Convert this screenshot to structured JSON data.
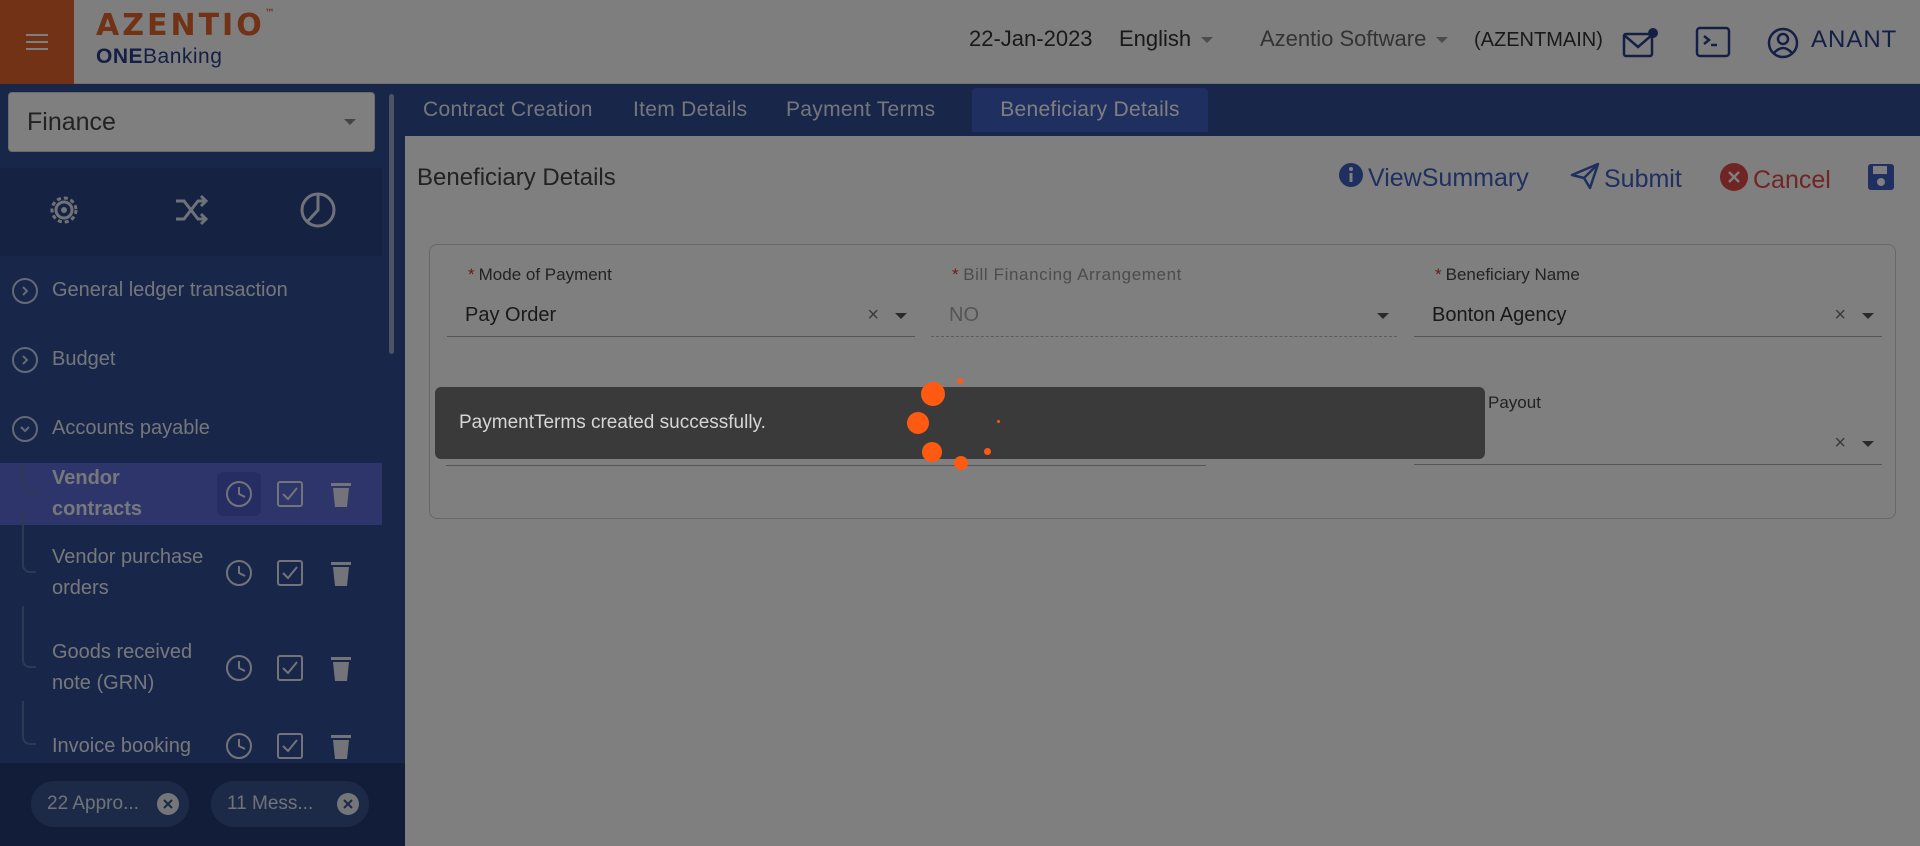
{
  "header": {
    "logo_brand": "AZENTIO",
    "logo_tm": "™",
    "logo_sub_bold": "ONE",
    "logo_sub_rest": "Banking",
    "date": "22-Jan-2023",
    "language": "English",
    "company": "Azentio Software",
    "branch": "(AZENTMAIN)",
    "user": "ANANT",
    "icons": [
      "menu-icon",
      "mail-icon",
      "terminal-icon",
      "user-icon"
    ]
  },
  "sidebar": {
    "module": "Finance",
    "tools": [
      "gear-icon",
      "shuffle-icon",
      "pie-chart-icon"
    ],
    "groups": [
      {
        "label": "General ledger transaction",
        "expanded": false
      },
      {
        "label": "Budget",
        "expanded": false
      },
      {
        "label": "Accounts payable",
        "expanded": true
      }
    ],
    "items": [
      {
        "label": "Vendor contracts",
        "active": true
      },
      {
        "label": "Vendor purchase orders",
        "active": false
      },
      {
        "label": "Goods received note (GRN)",
        "active": false
      },
      {
        "label": "Invoice booking",
        "active": false
      }
    ],
    "chips": [
      "22 Appro...",
      "11 Mess..."
    ]
  },
  "tabs": [
    {
      "label": "Contract Creation",
      "active": false
    },
    {
      "label": "Item Details",
      "active": false
    },
    {
      "label": "Payment Terms",
      "active": false
    },
    {
      "label": "Beneficiary Details",
      "active": true
    }
  ],
  "page": {
    "title": "Beneficiary Details",
    "view_summary": "ViewSummary",
    "submit": "Submit",
    "cancel": "Cancel"
  },
  "form": {
    "mode_of_payment": {
      "label": "Mode of Payment",
      "value": "Pay Order"
    },
    "bill_financing": {
      "label": "Bill Financing Arrangement",
      "value": "NO"
    },
    "beneficiary_name": {
      "label": "Beneficiary Name",
      "value": "Bonton Agency"
    },
    "payout": {
      "label": "Payout",
      "value": ""
    }
  },
  "toast": {
    "message": "PaymentTerms created successfully."
  },
  "colors": {
    "brand_orange": "#e2642a",
    "navy": "#2f4d92",
    "active_item": "#5c6bd6",
    "cancel_red": "#e04848",
    "spinner": "#ff5a12"
  }
}
